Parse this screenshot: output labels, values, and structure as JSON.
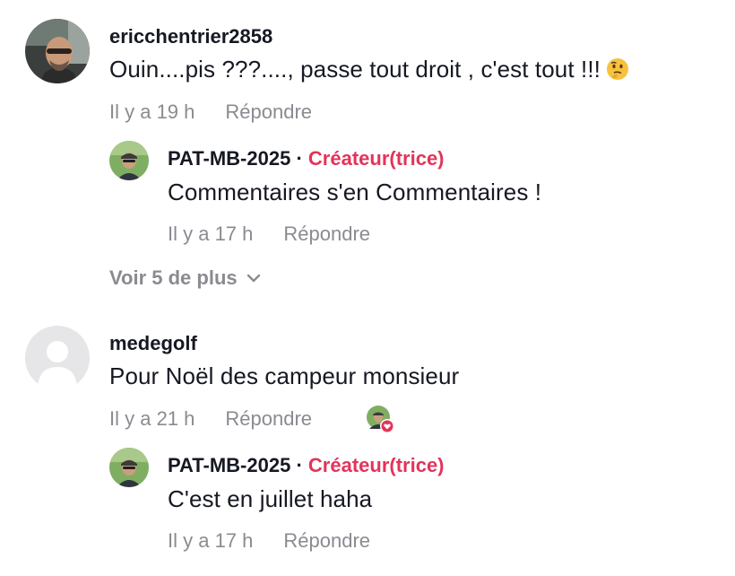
{
  "thread": [
    {
      "username": "ericchentrier2858",
      "text": "Ouin....pis ???...., passe tout droit , c'est tout !!!",
      "emoji": "thinking-face-icon",
      "time": "Il y a 19 h",
      "reply_label": "Répondre",
      "reply": {
        "username": "PAT-MB-2025",
        "separator": "·",
        "badge": "Créateur(trice)",
        "text": "Commentaires s'en Commentaires !",
        "time": "Il y a 17 h",
        "reply_label": "Répondre"
      },
      "more_label": "Voir 5 de plus"
    },
    {
      "username": "medegolf",
      "text": "Pour Noël des campeur monsieur",
      "time": "Il y a 21 h",
      "reply_label": "Répondre",
      "reply": {
        "username": "PAT-MB-2025",
        "separator": "·",
        "badge": "Créateur(trice)",
        "text": "C'est en juillet haha",
        "time": "Il y a 17 h",
        "reply_label": "Répondre"
      }
    }
  ],
  "colors": {
    "creator_badge": "#e2345a",
    "meta": "#8a8b91",
    "text": "#161823"
  }
}
